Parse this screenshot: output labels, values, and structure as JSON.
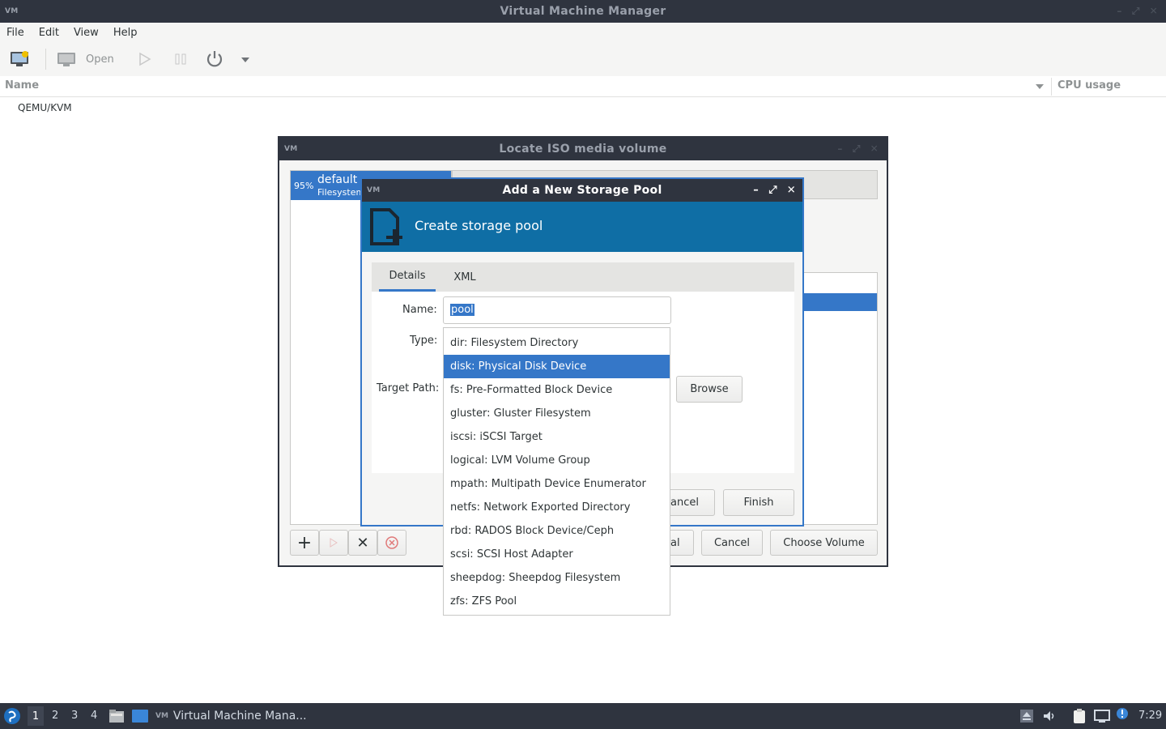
{
  "main_window": {
    "title": "Virtual Machine Manager",
    "menu": [
      "File",
      "Edit",
      "View",
      "Help"
    ],
    "toolbar": {
      "open_label": "Open"
    },
    "columns": {
      "name": "Name",
      "cpu": "CPU usage"
    },
    "connections": [
      "QEMU/KVM"
    ]
  },
  "locate_dialog": {
    "title": "Locate ISO media volume",
    "pool": {
      "usage": "95%",
      "name": "default",
      "type": "Filesystem"
    },
    "buttons": {
      "cancel_partial": "al",
      "cancel": "Cancel",
      "choose": "Choose Volume"
    }
  },
  "pool_dialog": {
    "title": "Add a New Storage Pool",
    "header": "Create storage pool",
    "tabs": [
      "Details",
      "XML"
    ],
    "name_label": "Name:",
    "name_value": "pool",
    "type_label": "Type:",
    "target_label": "Target Path:",
    "browse": "Browse",
    "cancel_partial": "ancel",
    "finish": "Finish",
    "type_options": [
      "dir: Filesystem Directory",
      "disk: Physical Disk Device",
      "fs: Pre-Formatted Block Device",
      "gluster: Gluster Filesystem",
      "iscsi: iSCSI Target",
      "logical: LVM Volume Group",
      "mpath: Multipath Device Enumerator",
      "netfs: Network Exported Directory",
      "rbd: RADOS Block Device/Ceph",
      "scsi: SCSI Host Adapter",
      "sheepdog: Sheepdog Filesystem",
      "zfs: ZFS Pool"
    ],
    "selected_option": "disk: Physical Disk Device"
  },
  "taskbar": {
    "workspaces": [
      "1",
      "2",
      "3",
      "4"
    ],
    "task_label": "Virtual Machine Mana...",
    "clock": "7:29"
  },
  "colors": {
    "titlebar": "#2f343f",
    "accent": "#0f6ea5",
    "selection": "#3577c8"
  }
}
